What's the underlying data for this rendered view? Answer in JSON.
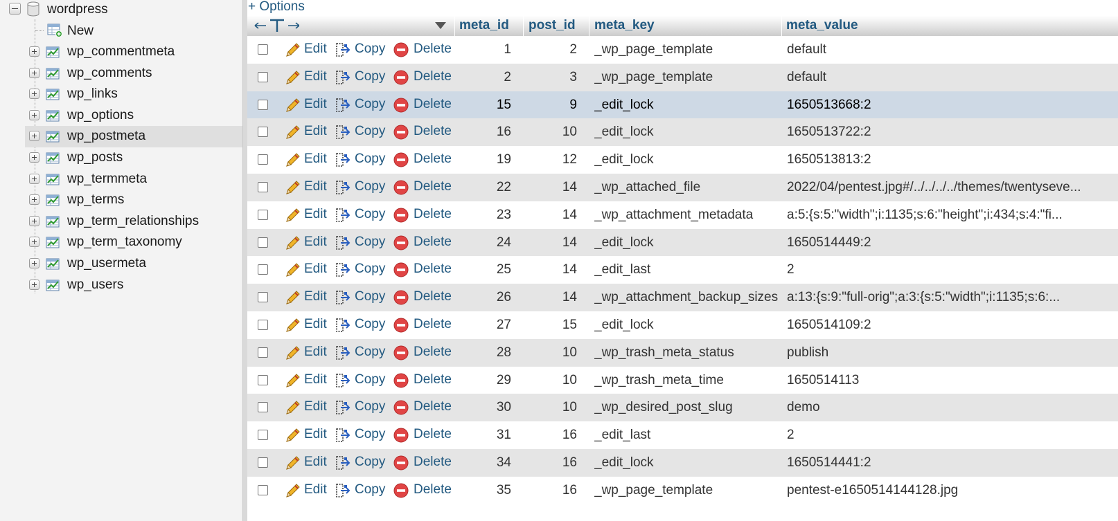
{
  "navigation": {
    "database": "wordpress",
    "new_label": "New",
    "tables": [
      "wp_commentmeta",
      "wp_comments",
      "wp_links",
      "wp_options",
      "wp_postmeta",
      "wp_posts",
      "wp_termmeta",
      "wp_terms",
      "wp_term_relationships",
      "wp_term_taxonomy",
      "wp_usermeta",
      "wp_users"
    ],
    "selected_table": "wp_postmeta"
  },
  "main": {
    "options_link": "+ Options",
    "columns": [
      "meta_id",
      "post_id",
      "meta_key",
      "meta_value"
    ],
    "actions": {
      "edit": "Edit",
      "copy": "Copy",
      "delete": "Delete"
    },
    "rows": [
      {
        "meta_id": "1",
        "post_id": "2",
        "meta_key": "_wp_page_template",
        "meta_value": "default"
      },
      {
        "meta_id": "2",
        "post_id": "3",
        "meta_key": "_wp_page_template",
        "meta_value": "default"
      },
      {
        "meta_id": "15",
        "post_id": "9",
        "meta_key": "_edit_lock",
        "meta_value": "1650513668:2"
      },
      {
        "meta_id": "16",
        "post_id": "10",
        "meta_key": "_edit_lock",
        "meta_value": "1650513722:2"
      },
      {
        "meta_id": "19",
        "post_id": "12",
        "meta_key": "_edit_lock",
        "meta_value": "1650513813:2"
      },
      {
        "meta_id": "22",
        "post_id": "14",
        "meta_key": "_wp_attached_file",
        "meta_value": "2022/04/pentest.jpg#/../../../../themes/twentyseve..."
      },
      {
        "meta_id": "23",
        "post_id": "14",
        "meta_key": "_wp_attachment_metadata",
        "meta_value": "a:5:{s:5:\"width\";i:1135;s:6:\"height\";i:434;s:4:\"fi..."
      },
      {
        "meta_id": "24",
        "post_id": "14",
        "meta_key": "_edit_lock",
        "meta_value": "1650514449:2"
      },
      {
        "meta_id": "25",
        "post_id": "14",
        "meta_key": "_edit_last",
        "meta_value": "2"
      },
      {
        "meta_id": "26",
        "post_id": "14",
        "meta_key": "_wp_attachment_backup_sizes",
        "meta_value": "a:13:{s:9:\"full-orig\";a:3:{s:5:\"width\";i:1135;s:6:..."
      },
      {
        "meta_id": "27",
        "post_id": "15",
        "meta_key": "_edit_lock",
        "meta_value": "1650514109:2"
      },
      {
        "meta_id": "28",
        "post_id": "10",
        "meta_key": "_wp_trash_meta_status",
        "meta_value": "publish"
      },
      {
        "meta_id": "29",
        "post_id": "10",
        "meta_key": "_wp_trash_meta_time",
        "meta_value": "1650514113"
      },
      {
        "meta_id": "30",
        "post_id": "10",
        "meta_key": "_wp_desired_post_slug",
        "meta_value": "demo"
      },
      {
        "meta_id": "31",
        "post_id": "16",
        "meta_key": "_edit_last",
        "meta_value": "2"
      },
      {
        "meta_id": "34",
        "post_id": "16",
        "meta_key": "_edit_lock",
        "meta_value": "1650514441:2"
      },
      {
        "meta_id": "35",
        "post_id": "16",
        "meta_key": "_wp_page_template",
        "meta_value": "pentest-e1650514144128.jpg"
      }
    ],
    "highlighted_row_meta_id": "15"
  },
  "colors": {
    "link": "#235a81",
    "row_even": "#e5e5e5",
    "row_highlight": "#ced9e5",
    "nav_background": "#f3f3f3"
  }
}
